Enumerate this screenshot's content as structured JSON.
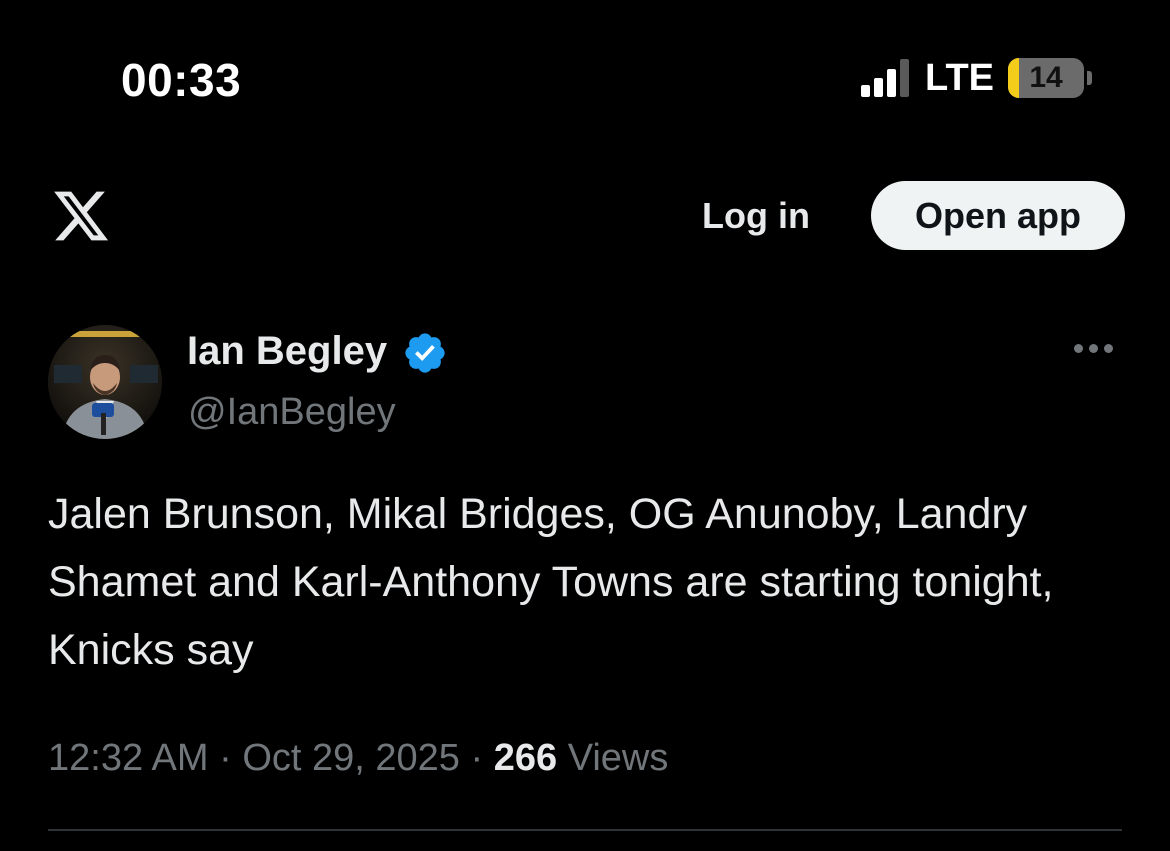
{
  "status_bar": {
    "time": "00:33",
    "network": "LTE",
    "battery_level": "14",
    "battery_fraction": 0.14,
    "signal_bars_active": 3,
    "signal_bars_total": 4
  },
  "header": {
    "logo": "x-logo-icon",
    "login_label": "Log in",
    "open_app_label": "Open app"
  },
  "tweet": {
    "author_name": "Ian Begley",
    "handle": "@IanBegley",
    "verified": true,
    "text": "Jalen Brunson, Mikal Bridges, OG Anunoby, Landry Shamet and Karl-Anthony Towns are starting tonight, Knicks say",
    "time": "12:32 AM",
    "date": "Oct 29, 2025",
    "separator": "·",
    "views_count": "266",
    "views_label": "Views"
  },
  "colors": {
    "background": "#000000",
    "primary_text": "#e7e9ea",
    "secondary_text": "#71767b",
    "verified_blue": "#1d9bf0",
    "battery_yellow": "#f4cd1a",
    "button_bg": "#eff3f4"
  }
}
